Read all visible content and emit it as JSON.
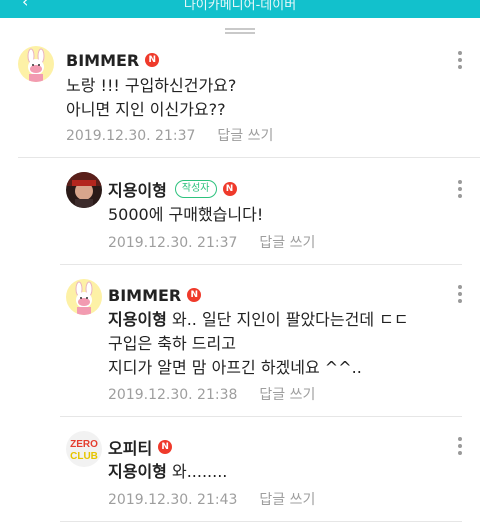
{
  "header": {
    "title": "다이카메디어-데이버",
    "back_icon": "chevron-left-icon"
  },
  "comments": [
    {
      "author": "BIMMER",
      "badge": "N",
      "lines": [
        "노랑 !!! 구입하신건가요?",
        "아니면 지인 이신가요??"
      ],
      "date": "2019.12.30. 21:37",
      "reply": "답글 쓰기"
    },
    {
      "author": "지용이형",
      "writer_tag": "작성자",
      "badge": "N",
      "lines": [
        "5000에 구매했습니다!"
      ],
      "date": "2019.12.30. 21:37",
      "reply": "답글 쓰기"
    },
    {
      "author": "BIMMER",
      "badge": "N",
      "mention": "지용이형",
      "lines": [
        " 와.. 일단 지인이 팔았다는건데 ㄷㄷ",
        "구입은 축하 드리고",
        "지디가 알면 맘 아프긴 하겠네요 ^^.."
      ],
      "date": "2019.12.30. 21:38",
      "reply": "답글 쓰기"
    },
    {
      "author": "오피티",
      "badge": "N",
      "mention": "지용이형",
      "lines": [
        " 와........"
      ],
      "date": "2019.12.30. 21:43",
      "reply": "답글 쓰기"
    }
  ],
  "avatar_texts": {
    "zero_top": "ZERO",
    "zero_bottom": "CLUB"
  },
  "colors": {
    "accent": "#12c1cc",
    "badge": "#ef3a2b",
    "writer": "#2ec27e"
  }
}
